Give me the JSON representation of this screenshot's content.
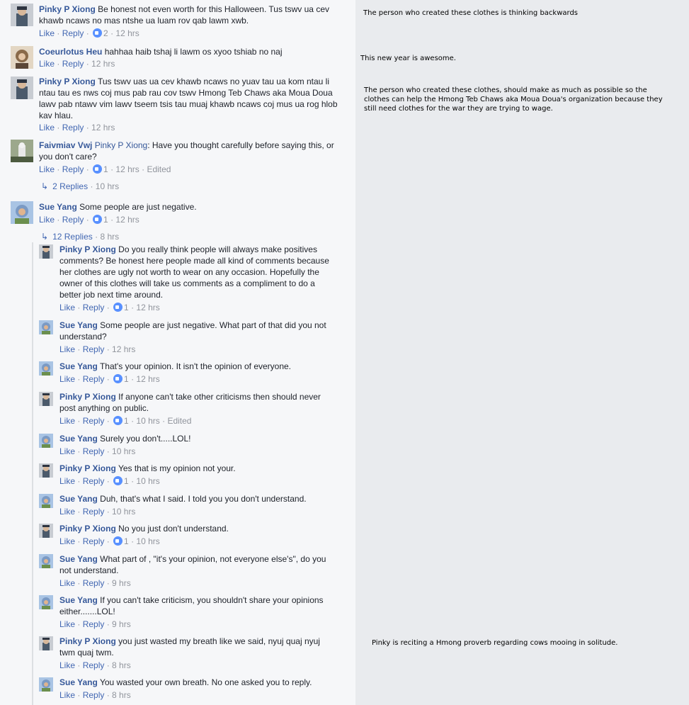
{
  "comments": [
    {
      "name": "Pinky P Xiong",
      "text": "Be honest not even worth for this Halloween. Tus tswv ua cev khawb ncaws no mas ntshe ua luam rov qab lawm xwb.",
      "like": "Like",
      "reply": "Reply",
      "likes": "2",
      "time": "12 hrs",
      "edited": ""
    },
    {
      "name": "Coeurlotus Heu",
      "text": "hahhaa haib tshaj li lawm os xyoo tshiab no naj",
      "like": "Like",
      "reply": "Reply",
      "likes": "",
      "time": "12 hrs",
      "edited": ""
    },
    {
      "name": "Pinky P Xiong",
      "text": "Tus tswv uas ua cev khawb ncaws no yuav tau ua kom ntau li ntau tau es nws coj mus pab rau cov tswv Hmong Teb Chaws aka Moua Doua lawv pab ntawv vim lawv tseem tsis tau muaj khawb ncaws coj mus ua rog hlob kav hlau.",
      "like": "Like",
      "reply": "Reply",
      "likes": "",
      "time": "12 hrs",
      "edited": ""
    },
    {
      "name": "Faivmiav Vwj",
      "tag": "Pinky P Xiong",
      "text": ": Have you thought carefully before saying this, or you don't care?",
      "like": "Like",
      "reply": "Reply",
      "likes": "1",
      "time": "12 hrs",
      "edited": "Edited",
      "replies": "2 Replies",
      "replies_time": "10 hrs"
    },
    {
      "name": "Sue Yang",
      "text": "Some people are just negative.",
      "like": "Like",
      "reply": "Reply",
      "likes": "1",
      "time": "12 hrs",
      "edited": "",
      "replies": "12 Replies",
      "replies_time": "8 hrs"
    }
  ],
  "replies": [
    {
      "name": "Pinky P Xiong",
      "text": "Do you really think people will always make positives comments? Be honest here people made all kind of comments because her clothes are ugly not worth to wear on any occasion. Hopefully the owner of this clothes will take us comments as a compliment to do a better job next time around.",
      "like": "Like",
      "reply": "Reply",
      "likes": "1",
      "time": "12 hrs",
      "edited": ""
    },
    {
      "name": "Sue Yang",
      "text": "Some people are just negative. What part of that did you not understand?",
      "like": "Like",
      "reply": "Reply",
      "likes": "",
      "time": "12 hrs",
      "edited": ""
    },
    {
      "name": "Sue Yang",
      "text": "That's your opinion. It isn't the opinion of everyone.",
      "like": "Like",
      "reply": "Reply",
      "likes": "1",
      "time": "12 hrs",
      "edited": ""
    },
    {
      "name": "Pinky P Xiong",
      "text": "If anyone can't take other criticisms then should never post anything on public.",
      "like": "Like",
      "reply": "Reply",
      "likes": "1",
      "time": "10 hrs",
      "edited": "Edited"
    },
    {
      "name": "Sue Yang",
      "text": "Surely you don't.....LOL!",
      "like": "Like",
      "reply": "Reply",
      "likes": "",
      "time": "10 hrs",
      "edited": ""
    },
    {
      "name": "Pinky P Xiong",
      "text": "Yes that is my opinion not your.",
      "like": "Like",
      "reply": "Reply",
      "likes": "1",
      "time": "10 hrs",
      "edited": ""
    },
    {
      "name": "Sue Yang",
      "text": "Duh, that's what I said. I told you you don't understand.",
      "like": "Like",
      "reply": "Reply",
      "likes": "",
      "time": "10 hrs",
      "edited": ""
    },
    {
      "name": "Pinky P Xiong",
      "text": "No you just don't understand.",
      "like": "Like",
      "reply": "Reply",
      "likes": "1",
      "time": "10 hrs",
      "edited": ""
    },
    {
      "name": "Sue Yang",
      "text": "What part of , \"it's your opinion, not everyone else's\", do you not understand.",
      "like": "Like",
      "reply": "Reply",
      "likes": "",
      "time": "9 hrs",
      "edited": ""
    },
    {
      "name": "Sue Yang",
      "text": "If you can't take criticism, you shouldn't share your opinions either.......LOL!",
      "like": "Like",
      "reply": "Reply",
      "likes": "",
      "time": "9 hrs",
      "edited": ""
    },
    {
      "name": "Pinky P Xiong",
      "text": "you just wasted my breath like we said, nyuj quaj nyuj twm quaj twm.",
      "like": "Like",
      "reply": "Reply",
      "likes": "",
      "time": "8 hrs",
      "edited": ""
    },
    {
      "name": "Sue Yang",
      "text": "You wasted your own breath. No one asked you to reply.",
      "like": "Like",
      "reply": "Reply",
      "likes": "",
      "time": "8 hrs",
      "edited": ""
    }
  ],
  "notes": [
    "The person who created these clothes is thinking backwards",
    "This new year is awesome.",
    "The person who created these clothes, should make as much as possible so the clothes can help the Hmong Teb Chaws aka Moua Doua's organization because they still need clothes for the war they are trying to wage.",
    "Pinky is reciting a Hmong proverb regarding cows mooing in solitude."
  ],
  "avatar_colors": {
    "pinky": "#4b5a6b",
    "coeurlotus": "#8a6a4a",
    "faivmiav": "#6d7a5d",
    "sue": "#7b9ac4"
  }
}
